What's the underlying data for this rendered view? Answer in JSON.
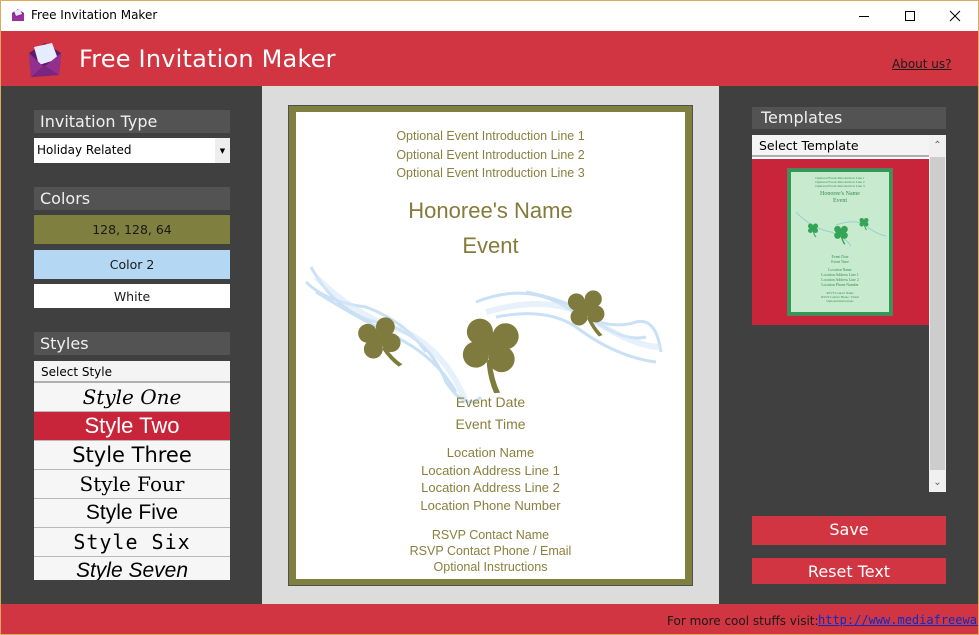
{
  "window": {
    "title": "Free Invitation Maker",
    "controls": {
      "minimize": "minimize-icon",
      "maximize": "maximize-icon",
      "close": "close-icon"
    }
  },
  "header": {
    "title": "Free Invitation Maker",
    "logo": "envelope-icon",
    "about_link": "About us?",
    "color": "#d13541"
  },
  "left": {
    "invitation_type": {
      "heading": "Invitation Type",
      "selected": "Holiday Related"
    },
    "colors": {
      "heading": "Colors",
      "color1": {
        "label": "128, 128, 64",
        "value": "#808040"
      },
      "color2": {
        "label": "Color 2",
        "value": "#b4d7f4"
      },
      "color3": {
        "label": "White",
        "value": "#ffffff"
      }
    },
    "styles": {
      "heading": "Styles",
      "select_label": "Select Style",
      "items": [
        {
          "label": "Style One",
          "selected": false
        },
        {
          "label": "Style Two",
          "selected": true
        },
        {
          "label": "Style Three",
          "selected": false
        },
        {
          "label": "Style Four",
          "selected": false
        },
        {
          "label": "Style Five",
          "selected": false
        },
        {
          "label": "Style Six",
          "selected": false
        },
        {
          "label": "Style Seven",
          "selected": false
        }
      ]
    }
  },
  "invitation": {
    "intro_lines": [
      "Optional Event Introduction Line 1",
      "Optional Event Introduction Line 2",
      "Optional Event Introduction Line 3"
    ],
    "honoree": "Honoree's Name",
    "event": "Event",
    "date": "Event Date",
    "time": "Event Time",
    "location": {
      "name": "Location Name",
      "address1": "Location Address Line 1",
      "address2": "Location Address Line 2",
      "phone": "Location Phone Number"
    },
    "rsvp": {
      "name": "RSVP Contact Name",
      "contact": "RSVP Contact Phone / Email",
      "instructions": "Optional Instructions"
    },
    "decoration": "shamrock-smoke-decoration",
    "text_color": "#8a7f3e",
    "border_color": "#7f7f3f"
  },
  "right": {
    "templates": {
      "heading": "Templates",
      "select_label": "Select Template",
      "thumbnail": {
        "intro_lines": [
          "Optional Event Introduction Line 1",
          "Optional Event Introduction Line 2",
          "Optional Event Introduction Line 3"
        ],
        "honoree": "Honoree's Name",
        "event": "Event",
        "date": "Event Date",
        "time": "Event Time",
        "location_lines": [
          "Location Name",
          "Location Address Line 1",
          "Location Address Line 2",
          "Location Phone Number"
        ],
        "rsvp_lines": [
          "RSVP Contact Name",
          "RSVP Contact Phone / Email",
          "Optional Instructions"
        ]
      }
    },
    "save_label": "Save",
    "reset_label": "Reset Text"
  },
  "footer": {
    "label": "For more cool stuffs visit:",
    "link": "http://www.mediafreeware.co"
  }
}
